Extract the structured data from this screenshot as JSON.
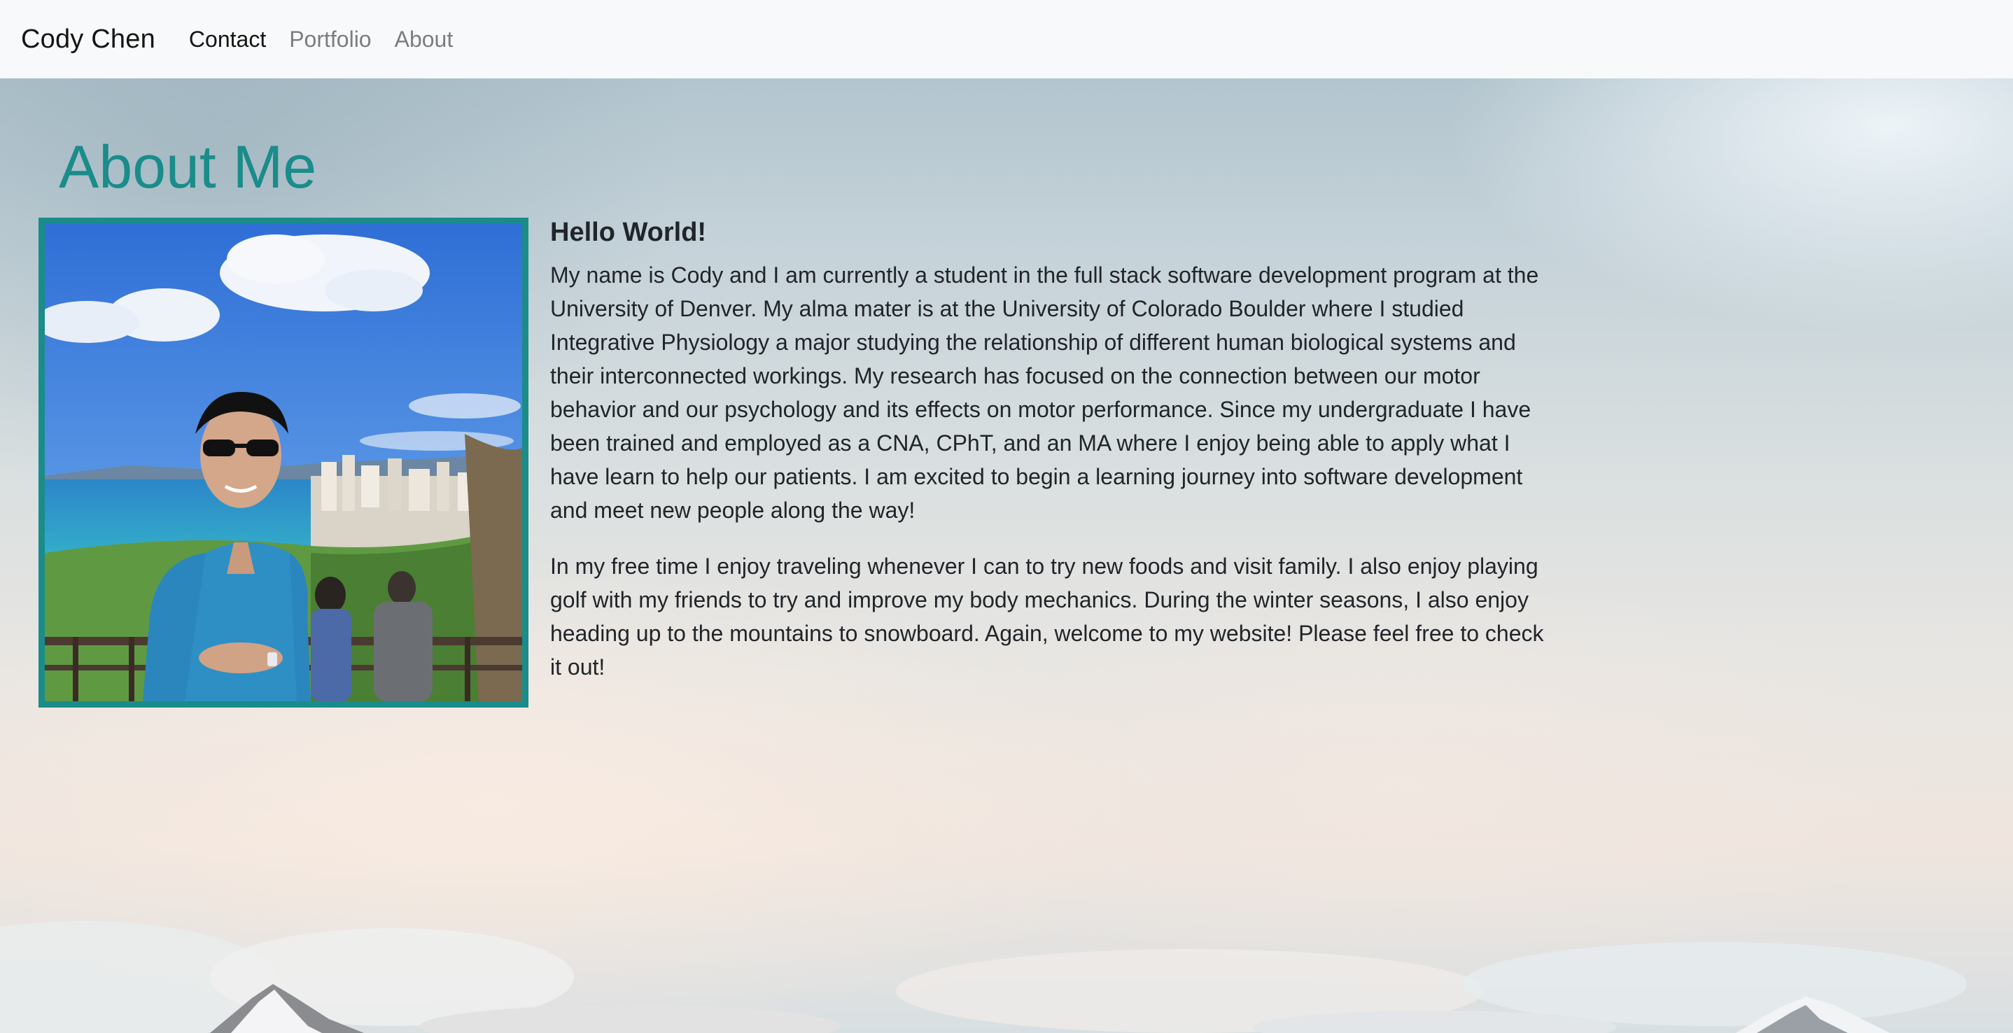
{
  "navbar": {
    "brand": "Cody Chen",
    "links": [
      {
        "label": "Contact",
        "active": true
      },
      {
        "label": "Portfolio",
        "active": false
      },
      {
        "label": "About",
        "active": false
      }
    ]
  },
  "main": {
    "title": "About Me",
    "subtitle": "Hello World!",
    "paragraphs": [
      "My name is Cody and I am currently a student in the full stack software development program at the University of Denver. My alma mater is at the University of Colorado Boulder where I studied Integrative Physiology a major studying the relationship of different human biological systems and their interconnected workings. My research has focused on the connection between our motor behavior and our psychology and its effects on motor performance. Since my undergraduate I have been trained and employed as a CNA, CPhT, and an MA where I enjoy being able to apply what I have learn to help our patients. I am excited to begin a learning journey into software development and meet new people along the way!",
      "In my free time I enjoy traveling whenever I can to try new foods and visit family. I also enjoy playing golf with my friends to try and improve my body mechanics. During the winter seasons, I also enjoy heading up to the mountains to snowboard. Again, welcome to my website! Please feel free to check it out!"
    ]
  },
  "colors": {
    "accent": "#1a8c8a",
    "navbar_bg": "#f8f9fa",
    "text": "#212529"
  }
}
